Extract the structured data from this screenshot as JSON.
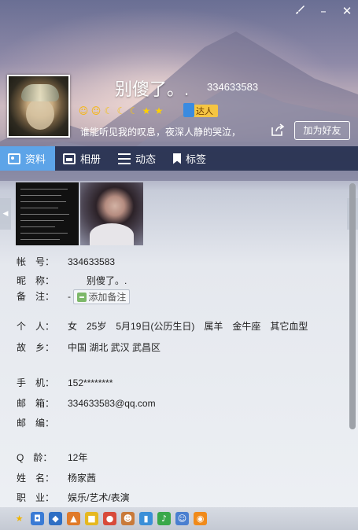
{
  "window": {
    "controls": {
      "skin_icon": "paintbrush-icon",
      "minimize": "–",
      "close": "✕"
    }
  },
  "profile": {
    "nickname": "别傻了。.",
    "qq_number": "334633583",
    "signature": "谁能听见我的叹息，夜深人静的哭泣，",
    "badge_text": "达人",
    "level_icons": [
      "sun-icon",
      "sun-icon",
      "moon-icon",
      "moon-icon",
      "moon-icon",
      "star-icon",
      "star-icon"
    ],
    "add_friend_label": "加为好友"
  },
  "tabs": [
    {
      "label": "资料",
      "icon": "profile-card-icon",
      "active": true
    },
    {
      "label": "相册",
      "icon": "photo-album-icon",
      "active": false
    },
    {
      "label": "动态",
      "icon": "feed-list-icon",
      "active": false
    },
    {
      "label": "标签",
      "icon": "tag-icon",
      "active": false
    }
  ],
  "info": {
    "account": {
      "label": "帐　号：",
      "value": "334633583"
    },
    "nick": {
      "label": "昵　称：",
      "value": "别傻了。."
    },
    "remark": {
      "label": "备　注：",
      "value": "-",
      "button": "添加备注"
    },
    "personal": {
      "label": "个　人：",
      "value": "女　25岁　5月19日(公历生日)　属羊　金牛座　其它血型"
    },
    "hometown": {
      "label": "故　乡：",
      "value": "中国 湖北 武汉 武昌区"
    },
    "phone": {
      "label": "手　机：",
      "value": "152********"
    },
    "email": {
      "label": "邮　箱：",
      "value": "334633583@qq.com"
    },
    "postcode": {
      "label": "邮　编：",
      "value": ""
    },
    "qage": {
      "label": "Q　龄：",
      "value": "12年"
    },
    "name": {
      "label": "姓　名：",
      "value": "杨家茜"
    },
    "job": {
      "label": "职　业：",
      "value": "娱乐/艺术/表演"
    }
  },
  "colors": {
    "tab_active": "#5da4e8",
    "tab_bar": "#222c4c",
    "badge": "#f5c542"
  },
  "statusbar_icons": [
    "star-icon",
    "camera-icon",
    "shield-icon",
    "boat-icon",
    "lock-icon",
    "game-icon",
    "pet-icon",
    "phone-icon",
    "music-icon",
    "people-icon",
    "penguin-icon"
  ]
}
